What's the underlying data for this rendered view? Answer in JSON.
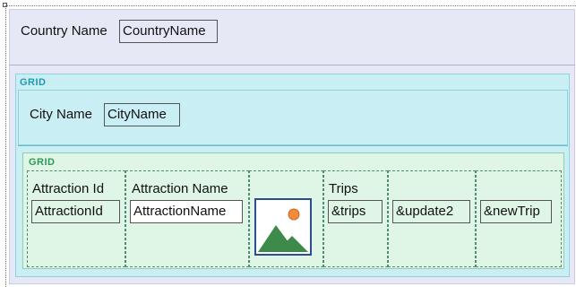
{
  "header": {
    "country_label": "Country Name",
    "country_field": "CountryName"
  },
  "grid_outer": {
    "title": "GRID",
    "city_label": "City Name",
    "city_field": "CityName"
  },
  "grid_inner": {
    "title": "GRID",
    "columns": [
      {
        "header": "Attraction Id",
        "field": "AttractionId"
      },
      {
        "header": "Attraction Name",
        "field": "AttractionName"
      },
      {
        "header": "",
        "field": "",
        "icon": "image-placeholder-icon"
      },
      {
        "header": "Trips",
        "field": "&trips"
      },
      {
        "header": "",
        "field": "&update2"
      },
      {
        "header": "",
        "field": "&newTrip"
      }
    ]
  },
  "colors": {
    "form_bg": "#e6e8f5",
    "outer_grid_bg": "#c9eef3",
    "outer_grid_title": "#1f9aae",
    "inner_grid_bg": "#dff5e6",
    "inner_grid_title": "#2c9a55",
    "picture_frame": "#2b4e8e",
    "picture_mountain": "#3d8a4a",
    "picture_sun": "#f08a3c"
  }
}
